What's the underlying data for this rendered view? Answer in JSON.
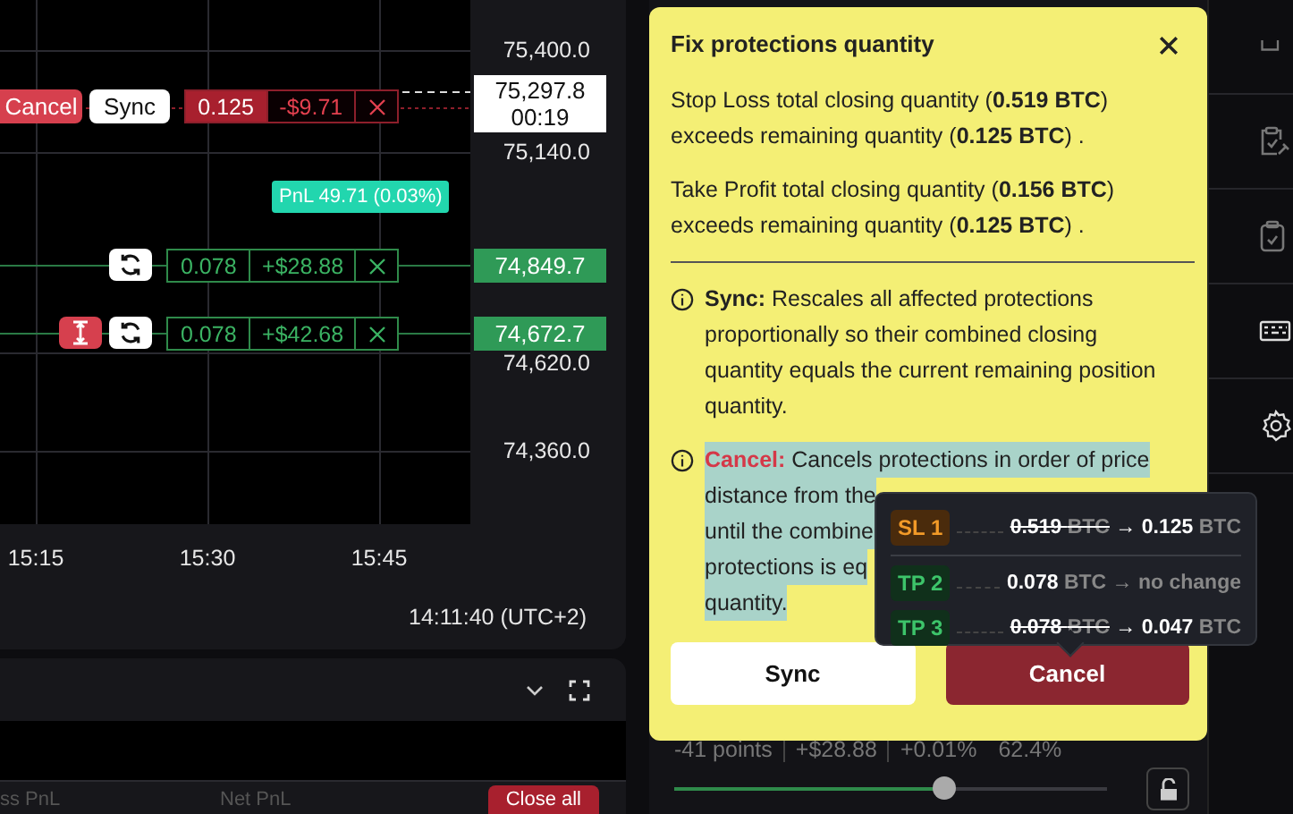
{
  "chart": {
    "price_labels": [
      {
        "text": "75,400.0",
        "kind": "r1"
      },
      {
        "text": "75,140.0",
        "kind": "r2"
      },
      {
        "text": "74,620.0",
        "kind": "r4"
      },
      {
        "text": "74,360.0",
        "kind": "r5"
      }
    ],
    "current_price": {
      "price": "75,297.8",
      "countdown": "00:19"
    },
    "position_order": {
      "cancel_label": "Cancel",
      "sync_label": "Sync",
      "quantity": "0.125",
      "pnl": "-$9.71"
    },
    "pnl_badge": "PnL 49.71 (0.03%)",
    "take_profits": [
      {
        "kind": "sync",
        "quantity": "0.078",
        "pnl": "+$28.88",
        "price": "74,849.7"
      },
      {
        "kind": "resize-sync",
        "quantity": "0.078",
        "pnl": "+$42.68",
        "price": "74,672.7"
      }
    ],
    "time_labels": [
      "15:15",
      "15:30",
      "15:45"
    ],
    "timestamp": "14:11:40 (UTC+2)"
  },
  "bottom_panel": {
    "columns": [
      "ss PnL",
      "Net PnL"
    ],
    "close_all": "Close all"
  },
  "position_panel": {
    "stats": [
      "-41 points",
      "+$28.88",
      "+0.01%"
    ],
    "percent": "62.4%",
    "slider": {
      "level": 0.624
    }
  },
  "dialog": {
    "title": "Fix protections quantity",
    "messages": [
      "Stop Loss total closing quantity (**0.519 BTC**) exceeds remaining quantity (**0.125 BTC**) .",
      "Take Profit total closing quantity (**0.156 BTC**) exceeds remaining quantity (**0.125 BTC**) ."
    ],
    "options": [
      {
        "kind": "sync",
        "label": "Sync:",
        "highlighted": false,
        "lines": [
          "Rescales all affected protections proportionally so their combined closing quantity equals the current remaining position quantity."
        ]
      },
      {
        "kind": "cancel",
        "label": "Cancel:",
        "highlighted": true,
        "lines": [
          "Cancels protections in order of price",
          "distance from the",
          "until the combine",
          "protections is eq",
          "quantity."
        ]
      }
    ],
    "buttons": [
      {
        "kind": "secondary",
        "label": "Sync"
      },
      {
        "kind": "primary",
        "label": "Cancel"
      }
    ]
  },
  "changes_tooltip": {
    "rows": [
      {
        "kind": "stop-loss",
        "tag": "SL 1",
        "changed": true,
        "old": "0.519",
        "old_unit": "BTC",
        "arrow": "→",
        "new": "0.125",
        "new_unit": "BTC"
      },
      {
        "kind": "take-profit",
        "tag": "TP 2",
        "changed": false,
        "old": "0.078",
        "old_unit": "BTC",
        "arrow": "→",
        "new": "no change"
      },
      {
        "kind": "take-profit",
        "tag": "TP 3",
        "changed": true,
        "old": "0.078",
        "old_unit": "BTC",
        "arrow": "→",
        "new": "0.047",
        "new_unit": "BTC"
      }
    ]
  }
}
